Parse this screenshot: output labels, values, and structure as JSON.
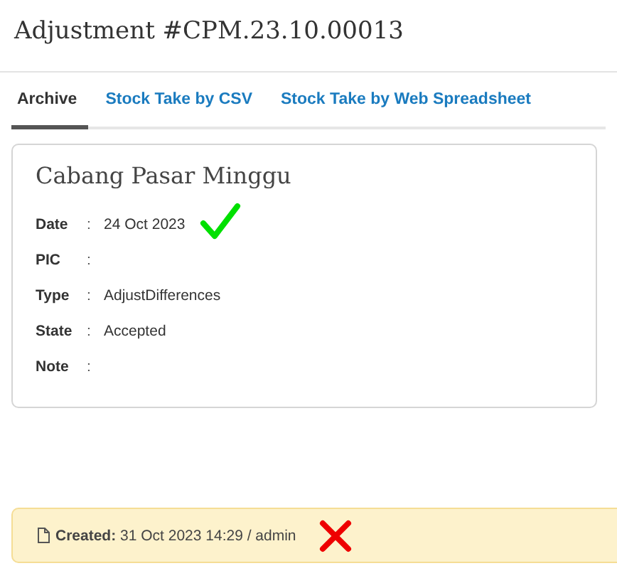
{
  "page_title": "Adjustment #CPM.23.10.00013",
  "tabs": [
    {
      "label": "Archive",
      "selected": true
    },
    {
      "label": "Stock Take by CSV",
      "selected": false
    },
    {
      "label": "Stock Take by Web Spreadsheet",
      "selected": false
    }
  ],
  "card": {
    "title": "Cabang Pasar Minggu",
    "fields": [
      {
        "label": "Date",
        "separator": ":",
        "value": "24 Oct 2023",
        "annotation": {
          "kind": "check"
        }
      },
      {
        "label": "PIC",
        "separator": ":"
      },
      {
        "label": "Type",
        "separator": ":",
        "value": "AdjustDifferences"
      },
      {
        "label": "State",
        "separator": ":",
        "value": "Accepted"
      },
      {
        "label": "Note",
        "separator": ":"
      }
    ]
  },
  "footer": {
    "text": "**Created:** 31 Oct 2023 14:29 / admin",
    "annotation": {
      "kind": "cross"
    }
  }
}
